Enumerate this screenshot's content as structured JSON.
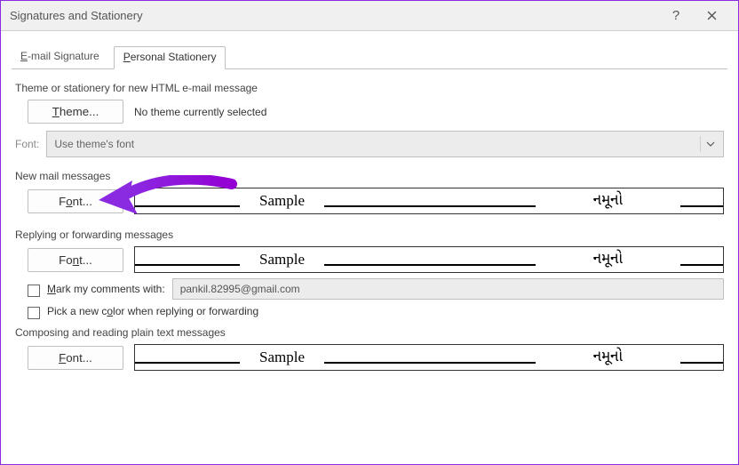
{
  "window": {
    "title": "Signatures and Stationery"
  },
  "tabs": {
    "email_signature": "E-mail Signature",
    "personal_stationery": "Personal Stationery"
  },
  "theme_section": {
    "title": "Theme or stationery for new HTML e-mail message",
    "theme_button": "Theme...",
    "no_theme_text": "No theme currently selected",
    "font_label": "Font:",
    "font_value": "Use theme's font"
  },
  "new_mail": {
    "title": "New mail messages",
    "font_button": "Font...",
    "sample_latin": "Sample",
    "sample_native": "નમૂનો"
  },
  "reply": {
    "title": "Replying or forwarding messages",
    "font_button": "Font...",
    "sample_latin": "Sample",
    "sample_native": "નમૂનો",
    "mark_comments_label": "Mark my comments with:",
    "mark_comments_value": "pankil.82995@gmail.com",
    "pick_color_label": "Pick a new color when replying or forwarding"
  },
  "plain": {
    "title": "Composing and reading plain text messages",
    "font_button": "Font...",
    "sample_latin": "Sample",
    "sample_native": "નમૂનો"
  }
}
